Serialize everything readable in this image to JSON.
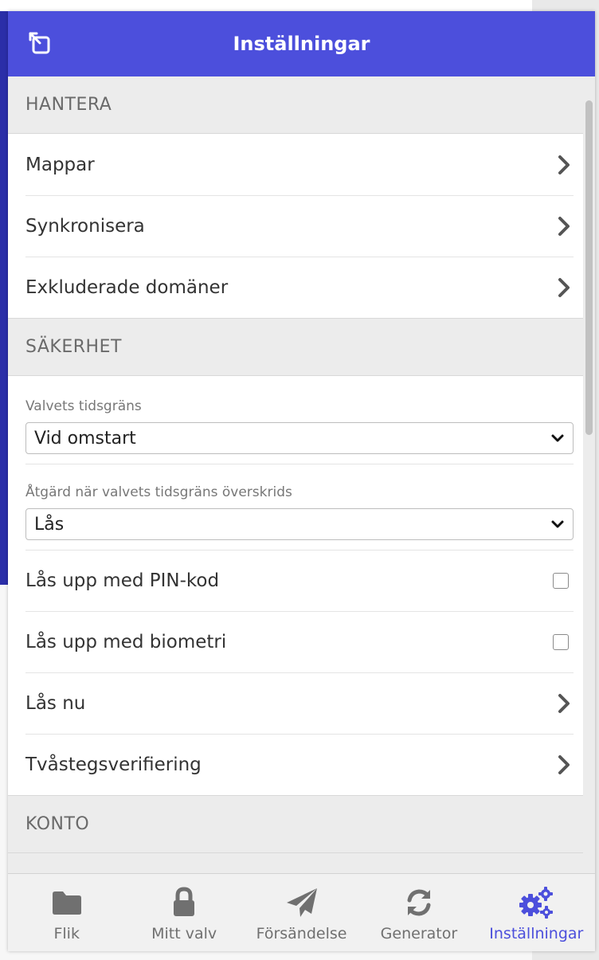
{
  "header": {
    "title": "Inställningar",
    "popout_icon": "popout-icon"
  },
  "sections": {
    "manage": {
      "title": "HANTERA",
      "items": [
        {
          "label": "Mappar"
        },
        {
          "label": "Synkronisera"
        },
        {
          "label": "Exkluderade domäner"
        }
      ]
    },
    "security": {
      "title": "SÄKERHET",
      "vault_timeout": {
        "label": "Valvets tidsgräns",
        "value": "Vid omstart"
      },
      "timeout_action": {
        "label": "Åtgärd när valvets tidsgräns överskrids",
        "value": "Lås"
      },
      "unlock_pin": {
        "label": "Lås upp med PIN-kod",
        "checked": false
      },
      "unlock_biometric": {
        "label": "Lås upp med biometri",
        "checked": false
      },
      "lock_now": {
        "label": "Lås nu"
      },
      "two_step": {
        "label": "Tvåstegsverifiering"
      }
    },
    "account": {
      "title": "KONTO"
    }
  },
  "tabs": [
    {
      "label": "Flik",
      "icon": "folder-icon",
      "active": false
    },
    {
      "label": "Mitt valv",
      "icon": "lock-icon",
      "active": false
    },
    {
      "label": "Försändelse",
      "icon": "send-icon",
      "active": false
    },
    {
      "label": "Generator",
      "icon": "refresh-icon",
      "active": false
    },
    {
      "label": "Inställningar",
      "icon": "cogs-icon",
      "active": true
    }
  ],
  "colors": {
    "brand": "#4c4fdc",
    "section_text": "#6a6a6a",
    "inactive_tab": "#707070"
  }
}
